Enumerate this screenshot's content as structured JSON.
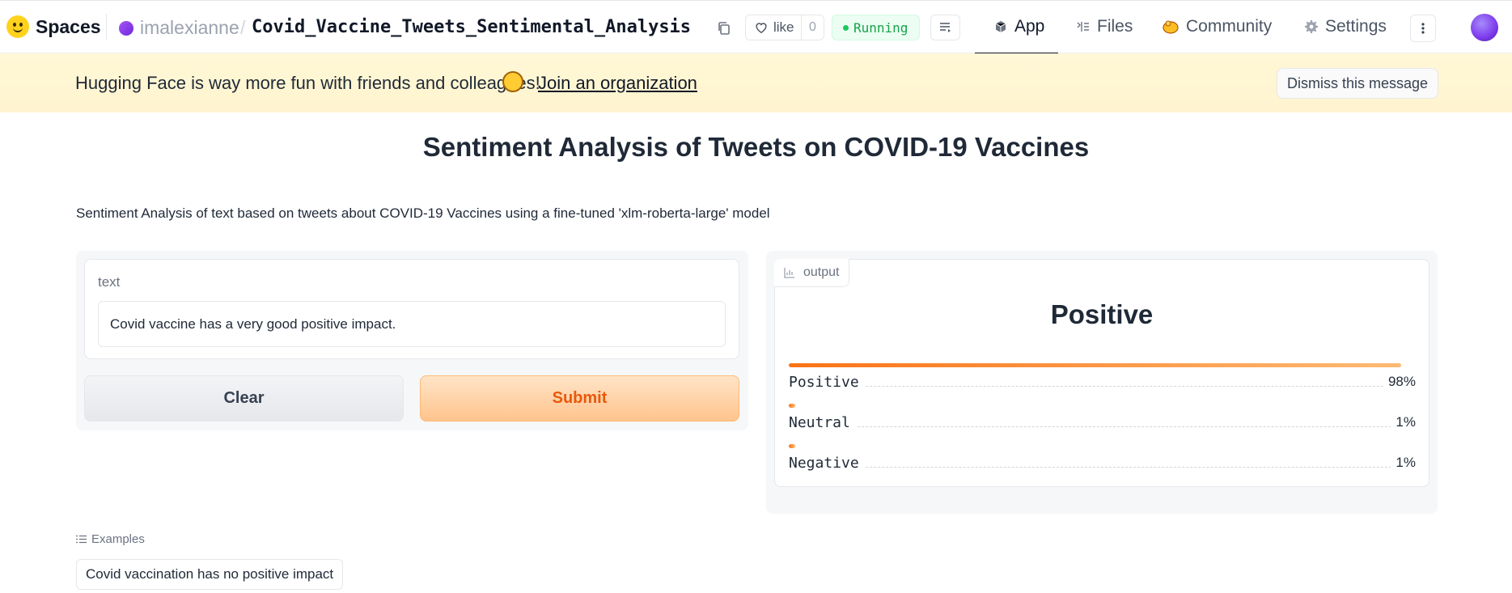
{
  "nav": {
    "brand": "Spaces",
    "owner": "imalexianne",
    "separator": "/",
    "repo": "Covid_Vaccine_Tweets_Sentimental_Analysis",
    "like_label": "like",
    "like_count": "0",
    "status": "Running",
    "tabs": [
      {
        "label": "App",
        "icon": "cube-icon"
      },
      {
        "label": "Files",
        "icon": "files-icon"
      },
      {
        "label": "Community",
        "icon": "community-icon"
      },
      {
        "label": "Settings",
        "icon": "gear-icon"
      }
    ]
  },
  "banner": {
    "message": "Hugging Face is way more fun with friends and colleagues!",
    "join_link": "Join an organization",
    "dismiss": "Dismiss this message"
  },
  "app": {
    "title": "Sentiment Analysis of Tweets on COVID-19 Vaccines",
    "description": "Sentiment Analysis of text based on tweets about COVID-19 Vaccines using a fine-tuned 'xlm-roberta-large' model",
    "input_label": "text",
    "input_value": "Covid vaccine has a very good positive impact.",
    "clear_label": "Clear",
    "submit_label": "Submit",
    "output_tag": "output",
    "output_label": "Positive",
    "confidences": [
      {
        "label": "Positive",
        "value": 0.98,
        "display": "98%"
      },
      {
        "label": "Neutral",
        "value": 0.01,
        "display": "1%"
      },
      {
        "label": "Negative",
        "value": 0.01,
        "display": "1%"
      }
    ],
    "examples_label": "Examples",
    "examples": [
      "Covid vaccination has no positive impact"
    ]
  },
  "colors": {
    "accent": "#f97316",
    "status_green": "#16a34a",
    "banner_bg": "#fff7d6"
  }
}
